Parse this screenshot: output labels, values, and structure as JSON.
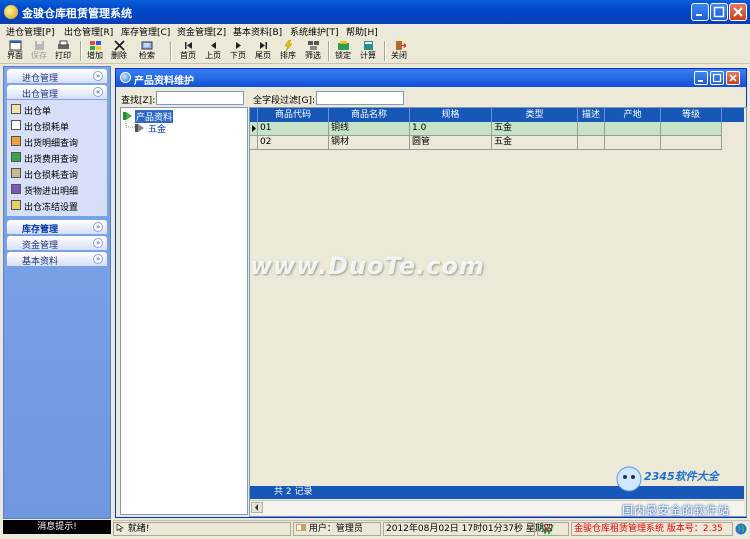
{
  "window": {
    "title": "金骏仓库租赁管理系统"
  },
  "menu": [
    "进仓管理[P]",
    "出仓管理[R]",
    "库存管理[C]",
    "资金管理[Z]",
    "基本资料[B]",
    "系统维护[T]",
    "帮助[H]"
  ],
  "toolbar": {
    "jiemian": "界面",
    "baocun": "保存",
    "dayin": "打印",
    "zengjia": "增加",
    "shanchu": "删除",
    "jiansuo": "检索",
    "shouye": "首页",
    "shangye": "上页",
    "xiaye": "下页",
    "weiye": "尾页",
    "paixu": "排序",
    "shaixuan": "筛选",
    "suoding": "锁定",
    "jisuan": "计算",
    "guanbi": "关闭"
  },
  "nav": {
    "groups": [
      "进仓管理",
      "出仓管理",
      "库存管理",
      "资金管理",
      "基本资料"
    ],
    "items": [
      "出仓单",
      "出仓损耗单",
      "出货明细查询",
      "出货费用查询",
      "出仓损耗查询",
      "货物进出明细",
      "出仓冻结设置"
    ]
  },
  "message_label": "消息提示!",
  "panel": {
    "title": "产品资料维护",
    "search_label": "查找[Z]:",
    "filter_label": "全字段过滤[G]:",
    "search_value": "",
    "filter_value": ""
  },
  "tree": {
    "root": "产品资料",
    "child": "五金"
  },
  "grid": {
    "columns": [
      "商品代码",
      "商品名称",
      "规格",
      "类型",
      "描述",
      "产地",
      "等级"
    ],
    "rows": [
      [
        "01",
        "铜线",
        "1.0",
        "五金",
        "",
        "",
        ""
      ],
      [
        "02",
        "钢材",
        "圆管",
        "五金",
        "",
        "",
        ""
      ]
    ],
    "footer": "共 2 记录"
  },
  "status": {
    "ready": "就绪!",
    "user": "用户：管理员",
    "datetime": "2012年08月02日  17时01分37秒  星期四",
    "app": "金骏仓库租赁管理系统 版本号：2.35"
  },
  "watermarks": {
    "duote": "www.DuoTe.com",
    "site": "2345软件大全",
    "slogan": "国内最安全的软件站"
  },
  "colors": {
    "titlebar": "#0046c8",
    "grid_header": "#1757b8",
    "selected_row": "#c6e3c6",
    "nav_panel": "#7fa7ea"
  }
}
